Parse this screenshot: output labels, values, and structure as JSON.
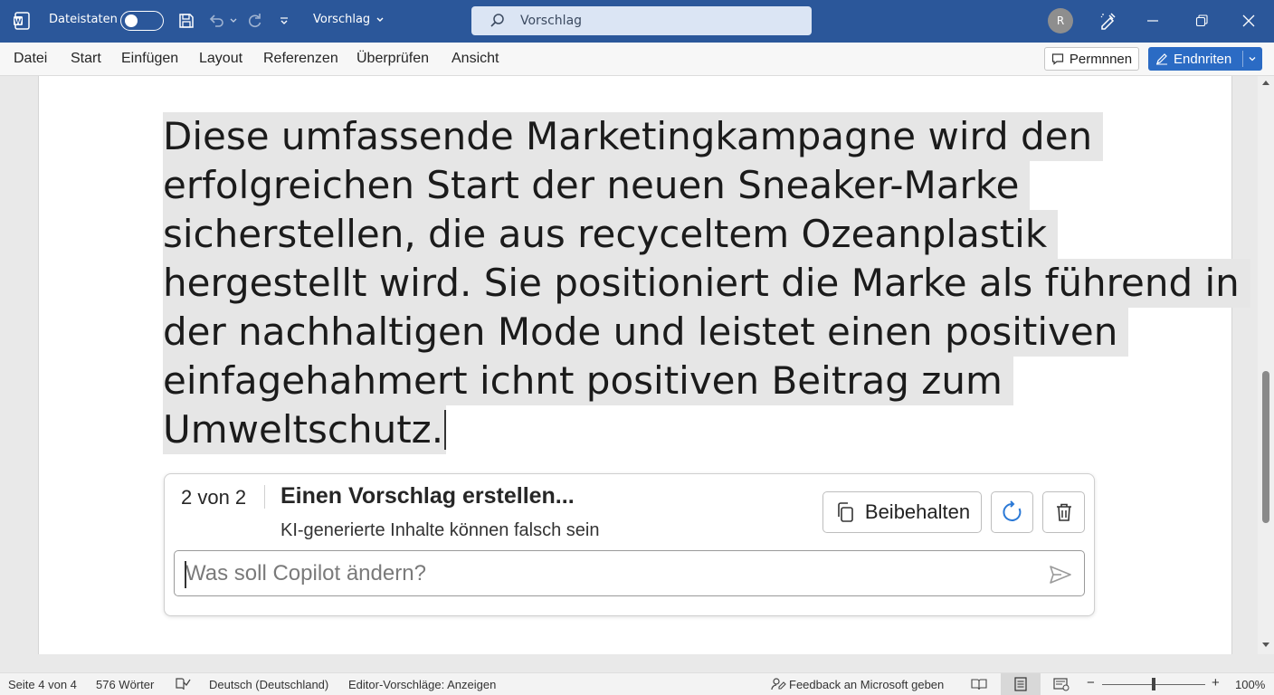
{
  "titlebar": {
    "autosave_label": "Dateistaten",
    "document_name": "Vorschlag",
    "search_text": "Vorschlag",
    "avatar_initial": "R",
    "bg_color": "#2b579a"
  },
  "ribbon": {
    "menu": [
      "Datei",
      "Start",
      "Einfügen",
      "Layout",
      "Referenzen",
      "Überprüfen",
      "Ansicht"
    ],
    "comments_label": "Permnnen",
    "edit_label": "Endnriten"
  },
  "document": {
    "lines": [
      "Diese umfassende Marketingkampagne wird den",
      "erfolgreichen Start der neuen Sneaker-Marke",
      "sicherstellen, die aus recyceltem Ozeanplastik",
      "hergestellt wird. Sie positioniert die Marke als führend in",
      "der nachhaltigen Mode und leistet einen positiven",
      "einfagehahmert ichnt positiven Beitrag zum",
      "Umweltschutz."
    ]
  },
  "copilot": {
    "counter": "2 von 2",
    "title": "Einen Vorschlag erstellen...",
    "disclaimer": "KI-generierte Inhalte können falsch sein",
    "keep_label": "Beibehalten",
    "prompt_placeholder": "Was soll Copilot ändern?"
  },
  "statusbar": {
    "page": "Seite 4 von 4",
    "words": "576 Wörter",
    "language": "Deutsch (Deutschland)",
    "editor": "Editor-Vorschläge: Anzeigen",
    "feedback": "Feedback an Microsoft geben",
    "zoom": "100%"
  },
  "icons": [
    "word-icon",
    "save-icon",
    "undo-icon",
    "redo-icon",
    "search-icon",
    "designer-icon",
    "comment-icon",
    "edit-icon",
    "copy-icon",
    "refresh-icon",
    "trash-icon",
    "send-icon",
    "proofing-icon",
    "feedback-icon",
    "read-mode-icon",
    "print-layout-icon",
    "web-layout-icon"
  ]
}
